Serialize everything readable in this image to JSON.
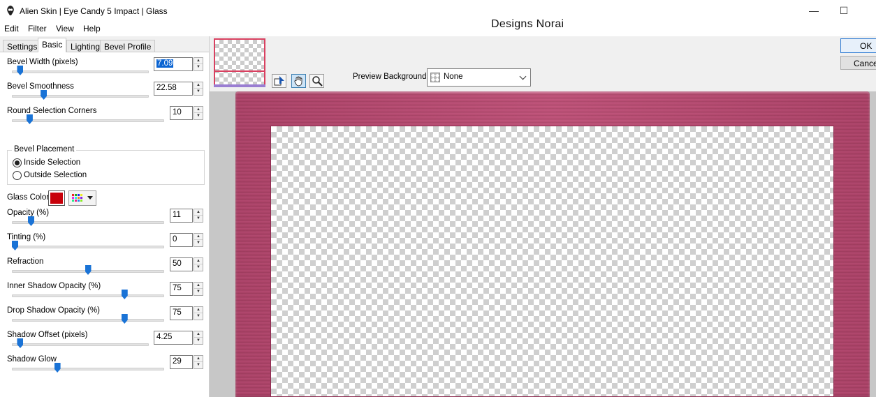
{
  "window": {
    "title": "Alien Skin | Eye Candy 5 Impact | Glass",
    "minimize_glyph": "—",
    "maximize_glyph": "☐",
    "watermark": "Designs Norai"
  },
  "menu": [
    "Edit",
    "Filter",
    "View",
    "Help"
  ],
  "tabs": [
    {
      "label": "Settings",
      "active": false
    },
    {
      "label": "Basic",
      "active": true
    },
    {
      "label": "Lighting",
      "active": false
    },
    {
      "label": "Bevel Profile",
      "active": false
    }
  ],
  "controls": {
    "bevel_width": {
      "label": "Bevel Width (pixels)",
      "value": "7.09",
      "slider": 0.04
    },
    "bevel_smoothness": {
      "label": "Bevel Smoothness",
      "value": "22.58",
      "slider": 0.22
    },
    "round_corners": {
      "label": "Round Selection Corners",
      "value": "10",
      "slider": 0.1
    },
    "bevel_placement": {
      "title": "Bevel Placement",
      "options": [
        "Inside Selection",
        "Outside Selection"
      ],
      "selected": "Inside Selection"
    },
    "glass_color": {
      "label": "Glass Color",
      "color": "#c8000a"
    },
    "opacity": {
      "label": "Opacity (%)",
      "value": "11",
      "slider": 0.11
    },
    "tinting": {
      "label": "Tinting (%)",
      "value": "0",
      "slider": 0.0
    },
    "refraction": {
      "label": "Refraction",
      "value": "50",
      "slider": 0.5
    },
    "inner_shadow": {
      "label": "Inner Shadow Opacity (%)",
      "value": "75",
      "slider": 0.75
    },
    "drop_shadow": {
      "label": "Drop Shadow Opacity (%)",
      "value": "75",
      "slider": 0.75
    },
    "shadow_offset": {
      "label": "Shadow Offset (pixels)",
      "value": "4.25",
      "slider": 0.04
    },
    "shadow_glow": {
      "label": "Shadow Glow",
      "value": "29",
      "slider": 0.29
    }
  },
  "preview": {
    "background_label": "Preview Background:",
    "background_value": "None",
    "tools": [
      "navigate-icon",
      "hand-icon",
      "zoom-icon"
    ]
  },
  "buttons": {
    "ok": "OK",
    "cancel": "Cancel"
  },
  "colors": {
    "frame": "#b94870",
    "selection_blue": "#0a64d2",
    "slider_thumb": "#1a73d6"
  }
}
